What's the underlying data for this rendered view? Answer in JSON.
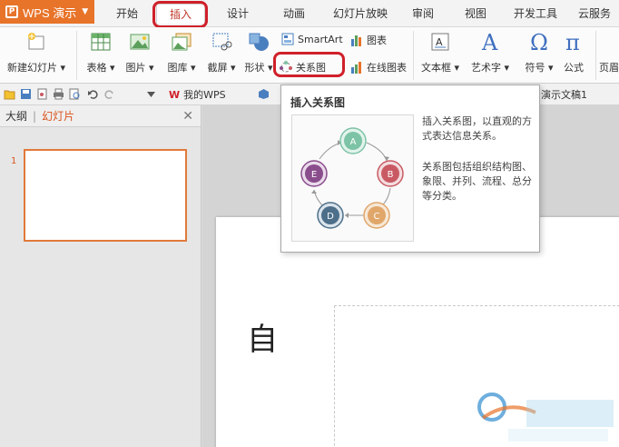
{
  "app": {
    "name": "WPS 演示",
    "logo_glyph": "P"
  },
  "tabs": [
    {
      "label": "开始",
      "active": false
    },
    {
      "label": "插入",
      "active": true
    },
    {
      "label": "设计",
      "active": false
    },
    {
      "label": "动画",
      "active": false
    },
    {
      "label": "幻灯片放映",
      "active": false
    },
    {
      "label": "审阅",
      "active": false
    },
    {
      "label": "视图",
      "active": false
    },
    {
      "label": "开发工具",
      "active": false
    },
    {
      "label": "云服务",
      "active": false
    }
  ],
  "ribbon": {
    "new_slide": "新建幻灯片",
    "table": "表格",
    "picture": "图片",
    "gallery": "图库",
    "screenshot": "截屏",
    "shape": "形状",
    "smartart": "SmartArt",
    "chart": "图表",
    "relation_chart": "关系图",
    "online_chart": "在线图表",
    "textbox": "文本框",
    "wordart": "艺术字",
    "symbol": "符号",
    "formula": "公式",
    "header_footer": "页眉"
  },
  "quickbar": {
    "my_wps": "我的WPS",
    "doc_title": "演示文稿1"
  },
  "left_panel": {
    "tab_outline": "大纲",
    "tab_slides": "幻灯片",
    "slide_number": "1"
  },
  "tooltip": {
    "title": "插入关系图",
    "desc1": "插入关系图，以直观的方式表达信息关系。",
    "desc2": "关系图包括组织结构图、象限、并列、流程、总分等分类。",
    "nodes": [
      {
        "label": "A",
        "color": "#7dc3a6"
      },
      {
        "label": "B",
        "color": "#c95a63"
      },
      {
        "label": "C",
        "color": "#e0a66a"
      },
      {
        "label": "D",
        "color": "#4d6f8a"
      },
      {
        "label": "E",
        "color": "#8a4d8c"
      }
    ]
  },
  "main": {
    "title_char": "自"
  },
  "colors": {
    "accent": "#e8742a",
    "highlight": "#d0202a",
    "active_tab_text": "#c0392b"
  }
}
